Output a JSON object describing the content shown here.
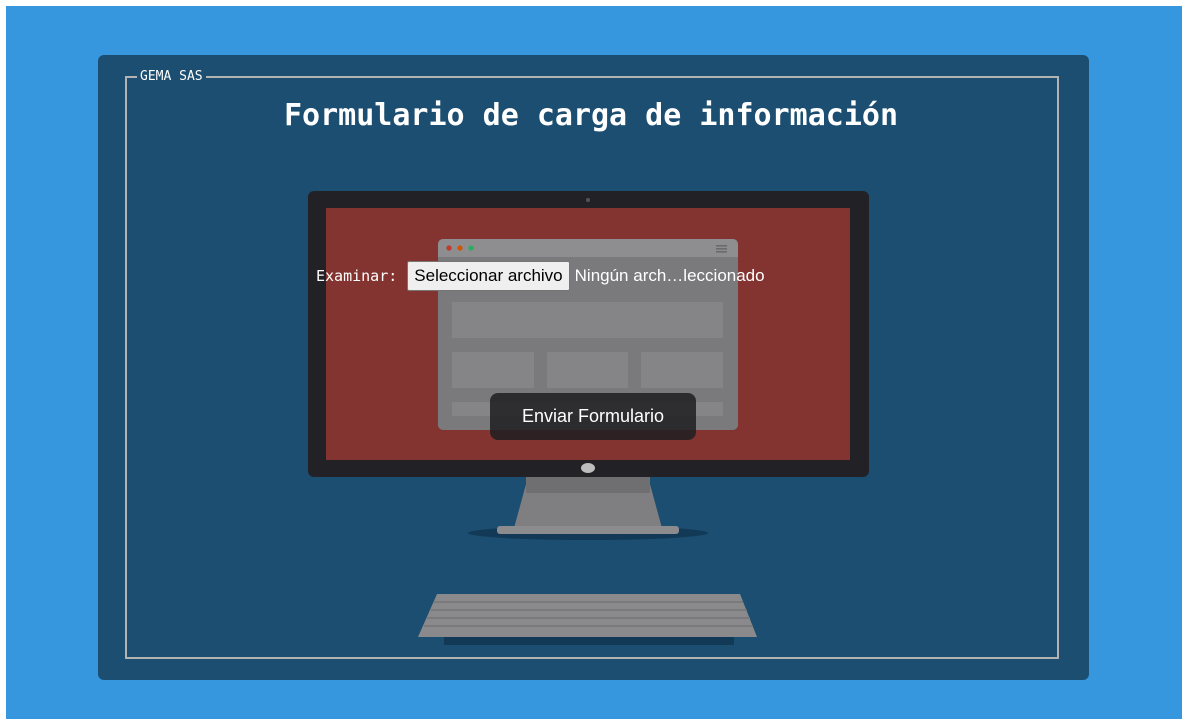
{
  "colors": {
    "page_background": "#3797de",
    "card_background": "#1b4e70",
    "screen_background": "#833430",
    "monitor_frame": "#222226",
    "button_dark": "#1e1e22"
  },
  "form": {
    "legend": "GEMA SAS",
    "title": "Formulario de carga de información",
    "file_label": "Examinar:",
    "file_button_label": "Seleccionar archivo",
    "file_status": "Ningún arch…leccionado",
    "submit_label": "Enviar Formulario"
  },
  "illustration": {
    "icon": "desktop-computer-illustration"
  }
}
